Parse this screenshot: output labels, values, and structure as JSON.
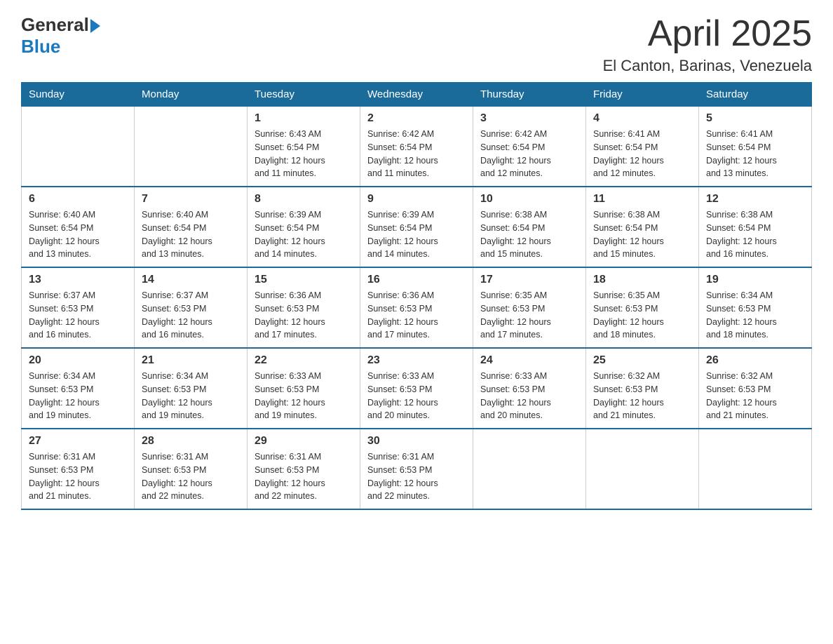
{
  "logo": {
    "text_general": "General",
    "text_blue": "Blue"
  },
  "title": "April 2025",
  "subtitle": "El Canton, Barinas, Venezuela",
  "days_of_week": [
    "Sunday",
    "Monday",
    "Tuesday",
    "Wednesday",
    "Thursday",
    "Friday",
    "Saturday"
  ],
  "weeks": [
    [
      {
        "day": "",
        "info": ""
      },
      {
        "day": "",
        "info": ""
      },
      {
        "day": "1",
        "info": "Sunrise: 6:43 AM\nSunset: 6:54 PM\nDaylight: 12 hours\nand 11 minutes."
      },
      {
        "day": "2",
        "info": "Sunrise: 6:42 AM\nSunset: 6:54 PM\nDaylight: 12 hours\nand 11 minutes."
      },
      {
        "day": "3",
        "info": "Sunrise: 6:42 AM\nSunset: 6:54 PM\nDaylight: 12 hours\nand 12 minutes."
      },
      {
        "day": "4",
        "info": "Sunrise: 6:41 AM\nSunset: 6:54 PM\nDaylight: 12 hours\nand 12 minutes."
      },
      {
        "day": "5",
        "info": "Sunrise: 6:41 AM\nSunset: 6:54 PM\nDaylight: 12 hours\nand 13 minutes."
      }
    ],
    [
      {
        "day": "6",
        "info": "Sunrise: 6:40 AM\nSunset: 6:54 PM\nDaylight: 12 hours\nand 13 minutes."
      },
      {
        "day": "7",
        "info": "Sunrise: 6:40 AM\nSunset: 6:54 PM\nDaylight: 12 hours\nand 13 minutes."
      },
      {
        "day": "8",
        "info": "Sunrise: 6:39 AM\nSunset: 6:54 PM\nDaylight: 12 hours\nand 14 minutes."
      },
      {
        "day": "9",
        "info": "Sunrise: 6:39 AM\nSunset: 6:54 PM\nDaylight: 12 hours\nand 14 minutes."
      },
      {
        "day": "10",
        "info": "Sunrise: 6:38 AM\nSunset: 6:54 PM\nDaylight: 12 hours\nand 15 minutes."
      },
      {
        "day": "11",
        "info": "Sunrise: 6:38 AM\nSunset: 6:54 PM\nDaylight: 12 hours\nand 15 minutes."
      },
      {
        "day": "12",
        "info": "Sunrise: 6:38 AM\nSunset: 6:54 PM\nDaylight: 12 hours\nand 16 minutes."
      }
    ],
    [
      {
        "day": "13",
        "info": "Sunrise: 6:37 AM\nSunset: 6:53 PM\nDaylight: 12 hours\nand 16 minutes."
      },
      {
        "day": "14",
        "info": "Sunrise: 6:37 AM\nSunset: 6:53 PM\nDaylight: 12 hours\nand 16 minutes."
      },
      {
        "day": "15",
        "info": "Sunrise: 6:36 AM\nSunset: 6:53 PM\nDaylight: 12 hours\nand 17 minutes."
      },
      {
        "day": "16",
        "info": "Sunrise: 6:36 AM\nSunset: 6:53 PM\nDaylight: 12 hours\nand 17 minutes."
      },
      {
        "day": "17",
        "info": "Sunrise: 6:35 AM\nSunset: 6:53 PM\nDaylight: 12 hours\nand 17 minutes."
      },
      {
        "day": "18",
        "info": "Sunrise: 6:35 AM\nSunset: 6:53 PM\nDaylight: 12 hours\nand 18 minutes."
      },
      {
        "day": "19",
        "info": "Sunrise: 6:34 AM\nSunset: 6:53 PM\nDaylight: 12 hours\nand 18 minutes."
      }
    ],
    [
      {
        "day": "20",
        "info": "Sunrise: 6:34 AM\nSunset: 6:53 PM\nDaylight: 12 hours\nand 19 minutes."
      },
      {
        "day": "21",
        "info": "Sunrise: 6:34 AM\nSunset: 6:53 PM\nDaylight: 12 hours\nand 19 minutes."
      },
      {
        "day": "22",
        "info": "Sunrise: 6:33 AM\nSunset: 6:53 PM\nDaylight: 12 hours\nand 19 minutes."
      },
      {
        "day": "23",
        "info": "Sunrise: 6:33 AM\nSunset: 6:53 PM\nDaylight: 12 hours\nand 20 minutes."
      },
      {
        "day": "24",
        "info": "Sunrise: 6:33 AM\nSunset: 6:53 PM\nDaylight: 12 hours\nand 20 minutes."
      },
      {
        "day": "25",
        "info": "Sunrise: 6:32 AM\nSunset: 6:53 PM\nDaylight: 12 hours\nand 21 minutes."
      },
      {
        "day": "26",
        "info": "Sunrise: 6:32 AM\nSunset: 6:53 PM\nDaylight: 12 hours\nand 21 minutes."
      }
    ],
    [
      {
        "day": "27",
        "info": "Sunrise: 6:31 AM\nSunset: 6:53 PM\nDaylight: 12 hours\nand 21 minutes."
      },
      {
        "day": "28",
        "info": "Sunrise: 6:31 AM\nSunset: 6:53 PM\nDaylight: 12 hours\nand 22 minutes."
      },
      {
        "day": "29",
        "info": "Sunrise: 6:31 AM\nSunset: 6:53 PM\nDaylight: 12 hours\nand 22 minutes."
      },
      {
        "day": "30",
        "info": "Sunrise: 6:31 AM\nSunset: 6:53 PM\nDaylight: 12 hours\nand 22 minutes."
      },
      {
        "day": "",
        "info": ""
      },
      {
        "day": "",
        "info": ""
      },
      {
        "day": "",
        "info": ""
      }
    ]
  ]
}
